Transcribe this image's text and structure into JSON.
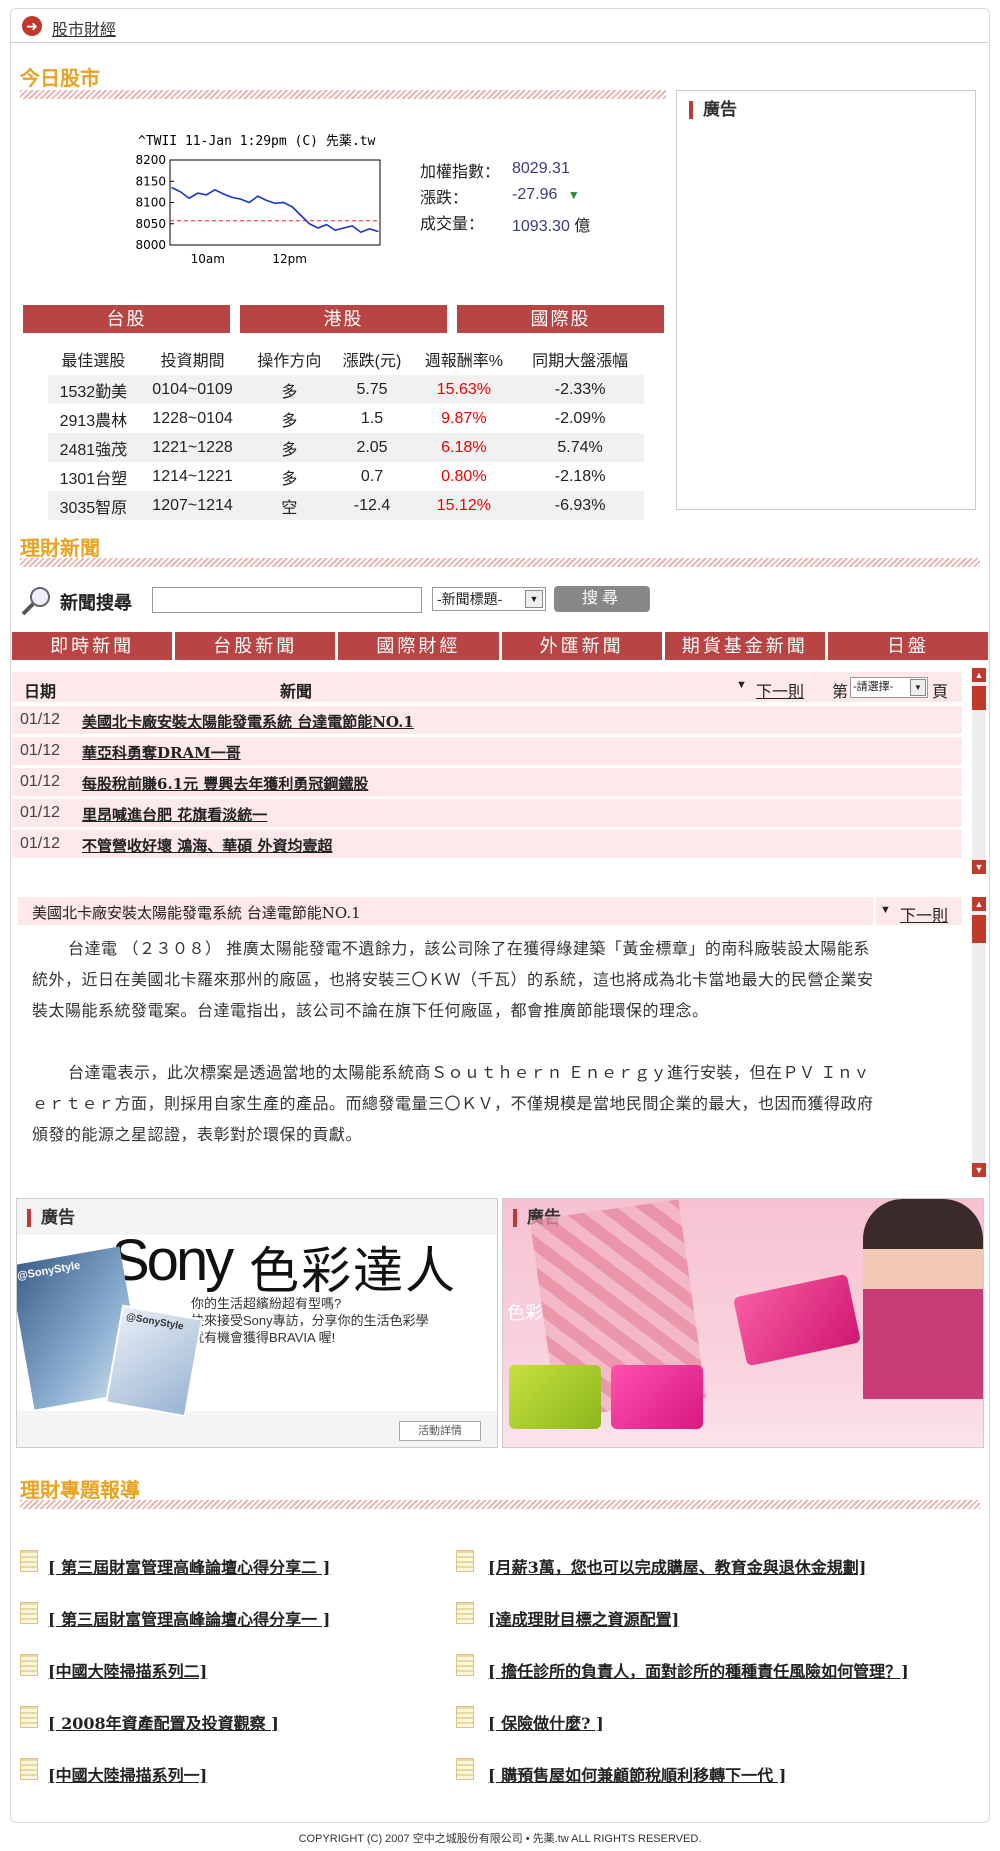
{
  "crumb": "股市財經",
  "stock": {
    "title": "今日股市",
    "chart_caption": "^TWII 11-Jan 1:29pm (C) 先薬.tw",
    "index_label": "加權指數：",
    "index_value": "8029.31",
    "change_label": "漲跌：",
    "change_value": "-27.96",
    "volume_label": "成交量：",
    "volume_value": "1093.30",
    "volume_unit": "億",
    "tabs": [
      "台股",
      "港股",
      "國際股"
    ],
    "table_headers": [
      "最佳選股",
      "投資期間",
      "操作方向",
      "漲跌(元)",
      "週報酬率%",
      "同期大盤漲幅"
    ],
    "rows": [
      [
        "1532勤美",
        "0104~0109",
        "多",
        "5.75",
        "15.63%",
        "-2.33%"
      ],
      [
        "2913農林",
        "1228~0104",
        "多",
        "1.5",
        "9.87%",
        "-2.09%"
      ],
      [
        "2481強茂",
        "1221~1228",
        "多",
        "2.05",
        "6.18%",
        "5.74%"
      ],
      [
        "1301台塑",
        "1214~1221",
        "多",
        "0.7",
        "0.80%",
        "-2.18%"
      ],
      [
        "3035智原",
        "1207~1214",
        "空",
        "-12.4",
        "15.12%",
        "-6.93%"
      ]
    ]
  },
  "chart_data": {
    "type": "line",
    "title": "^TWII 11-Jan 1:29pm (C) 先薬.tw",
    "y_ticks": [
      "8200",
      "8150",
      "8100",
      "8050",
      "8000"
    ],
    "x_ticks": [
      "10am",
      "12pm"
    ],
    "ylim": [
      8000,
      8200
    ],
    "reference_line": 8057,
    "series": [
      {
        "values": [
          8135,
          8125,
          8110,
          8122,
          8118,
          8130,
          8120,
          8112,
          8108,
          8100,
          8115,
          8105,
          8098,
          8100,
          8090,
          8070,
          8050,
          8040,
          8048,
          8035,
          8040,
          8045,
          8030,
          8038,
          8032
        ]
      }
    ]
  },
  "ads": {
    "label": "廣告"
  },
  "news": {
    "title": "理財新聞",
    "search_label": "新聞搜尋",
    "search_select": "-新聞標題-",
    "search_button": "搜尋",
    "tabs": [
      "即時新聞",
      "台股新聞",
      "國際財經",
      "外匯新聞",
      "期貨基金新聞",
      "日盤"
    ],
    "col_date": "日期",
    "col_news": "新聞",
    "next": "下一則",
    "page_prefix": "第",
    "page_select": "-請選擇-",
    "page_suffix": "頁",
    "items": [
      {
        "date": "01/12",
        "title": "美國北卡廠安裝太陽能發電系統 台達電節能NO.1"
      },
      {
        "date": "01/12",
        "title": "華亞科勇奪DRAM一哥"
      },
      {
        "date": "01/12",
        "title": "每股稅前賺6.1元 豐興去年獲利勇冠鋼鐵股"
      },
      {
        "date": "01/12",
        "title": "里昂喊進台肥 花旗看淡統一"
      },
      {
        "date": "01/12",
        "title": "不管營收好壞 鴻海、華碩 外資均壹超"
      }
    ]
  },
  "article": {
    "title": "美國北卡廠安裝太陽能發電系統 台達電節能NO.1",
    "next": "下一則",
    "p1": "台達電 （２３０８） 推廣太陽能發電不遺餘力，該公司除了在獲得綠建築「黃金標章」的南科廠裝設太陽能系統外，近日在美國北卡羅來那州的廠區，也將安裝三〇ＫＷ（千瓦）的系統，這也將成為北卡當地最大的民營企業安裝太陽能系統發電案。台達電指出，該公司不論在旗下任何廠區，都會推廣節能環保的理念。",
    "p2": "台達電表示，此次標案是透過當地的太陽能系統商Ｓｏｕｔｈｅｒｎ Ｅｎｅｒｇｙ進行安裝，但在ＰＶ Ｉｎｖｅｒｔｅｒ方面，則採用自家生產的產品。而總發電量三〇ＫＶ，不僅規模是當地民間企業的最大，也因而獲得政府頒發的能源之星認證，表彰對於環保的貢獻。"
  },
  "sony_ad": {
    "brand": "Sony",
    "headline": "色彩達人",
    "line1": "你的生活超繽紛超有型嗎?",
    "line2": "快來接受Sony專訪，分享你的生活色彩學",
    "line3": "就有機會獲得BRAVIA 喔!",
    "tag1": "@SonyStyle",
    "tag2": "@SonyStyle",
    "detail_button": "活動詳情",
    "color_word": "色彩"
  },
  "reports": {
    "title": "理財專題報導",
    "left": [
      "[ 第三屆財富管理高峰論壇心得分享二 ]",
      "[ 第三屆財富管理高峰論壇心得分享一 ]",
      "[中國大陸掃描系列二]",
      "[ 2008年資產配置及投資觀察 ]",
      "[中國大陸掃描系列一]"
    ],
    "right": [
      "[月薪3萬，您也可以完成購屋、教育金與退休金規劃]",
      "[達成理財目標之資源配置]",
      "[ 擔任診所的負責人，面對診所的種種責任風險如何管理？]",
      "[ 保險做什麼? ]",
      "[ 購預售屋如何兼顧節稅順利移轉下一代 ]"
    ]
  },
  "footer": "COPYRIGHT (C) 2007 空中之城股份有限公司 • 先薬.tw ALL RIGHTS RESERVED."
}
